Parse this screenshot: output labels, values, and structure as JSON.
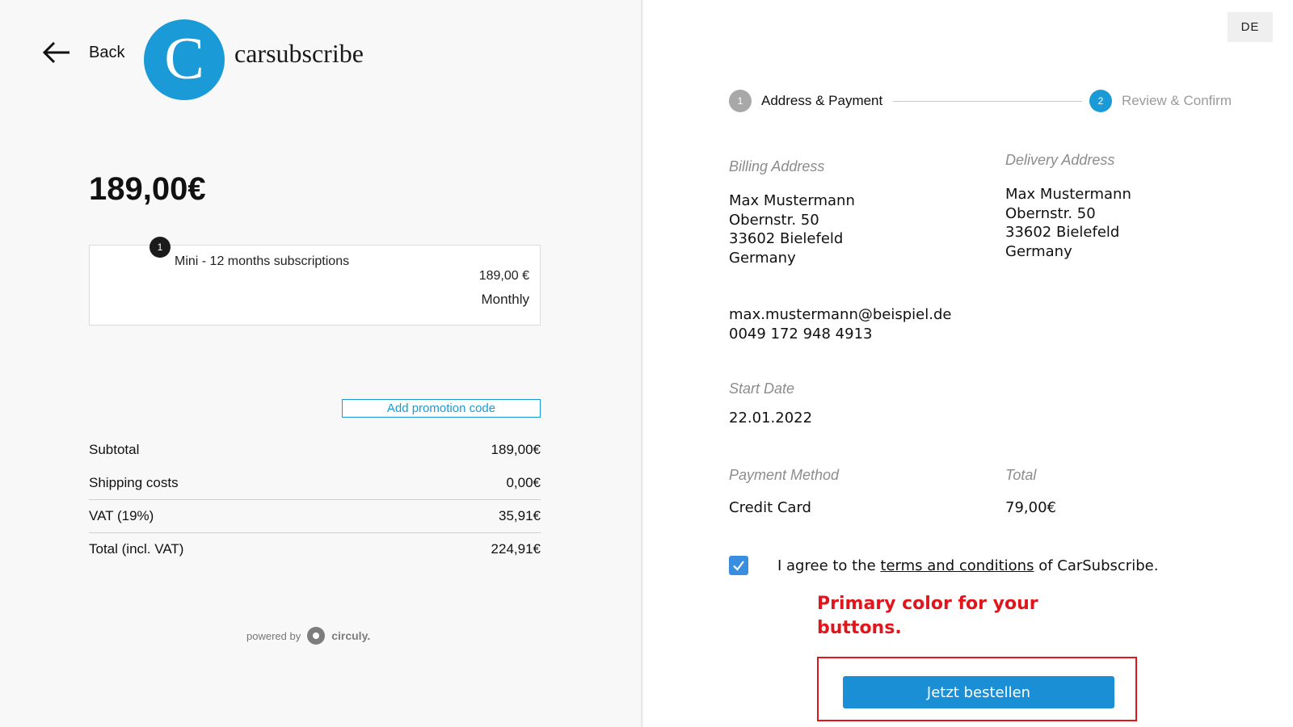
{
  "colors": {
    "brand": "#1a9ad6",
    "button": "#1a8fd6",
    "annotation": "#e0161c",
    "checkbox": "#3a8ee0"
  },
  "nav": {
    "back_label": "Back",
    "back_icon": "arrow-left-icon"
  },
  "brand": {
    "logo_letter": "C",
    "name": "carsubscribe"
  },
  "order": {
    "price": "189,00€",
    "item": {
      "quantity": "1",
      "name": "Mini - 12 months subscriptions",
      "price": "189,00 €",
      "period": "Monthly"
    },
    "promo_label": "Add promotion code",
    "summary": [
      {
        "label": "Subtotal",
        "value": "189,00€"
      },
      {
        "label": "Shipping costs",
        "value": "0,00€"
      },
      {
        "label": "VAT (19%)",
        "value": "35,91€"
      },
      {
        "label": "Total (incl. VAT)",
        "value": "224,91€"
      }
    ]
  },
  "footer": {
    "powered_by": "powered by",
    "provider": "circuly."
  },
  "language": "DE",
  "steps": [
    {
      "number": "1",
      "label": "Address & Payment",
      "state": "done"
    },
    {
      "number": "2",
      "label": "Review & Confirm",
      "state": "active"
    }
  ],
  "review": {
    "billing": {
      "title": "Billing Address",
      "lines": [
        "Max Mustermann",
        "Obernstr. 50",
        "33602 Bielefeld",
        "Germany"
      ]
    },
    "delivery": {
      "title": "Delivery Address",
      "lines": [
        "Max Mustermann",
        "Obernstr. 50",
        "33602 Bielefeld",
        "Germany"
      ]
    },
    "contact": {
      "email": "max.mustermann@beispiel.de",
      "phone": "0049 172 948 4913"
    },
    "start_date": {
      "title": "Start Date",
      "value": "22.01.2022"
    },
    "payment_method": {
      "title": "Payment Method",
      "value": "Credit Card"
    },
    "total": {
      "title": "Total",
      "value": "79,00€"
    }
  },
  "terms": {
    "prefix": "I agree to the ",
    "link": "terms and conditions",
    "suffix": " of CarSubscribe.",
    "checked": true
  },
  "annotation": {
    "line1": "Primary color for your",
    "line2": "buttons."
  },
  "submit_label": "Jetzt bestellen"
}
